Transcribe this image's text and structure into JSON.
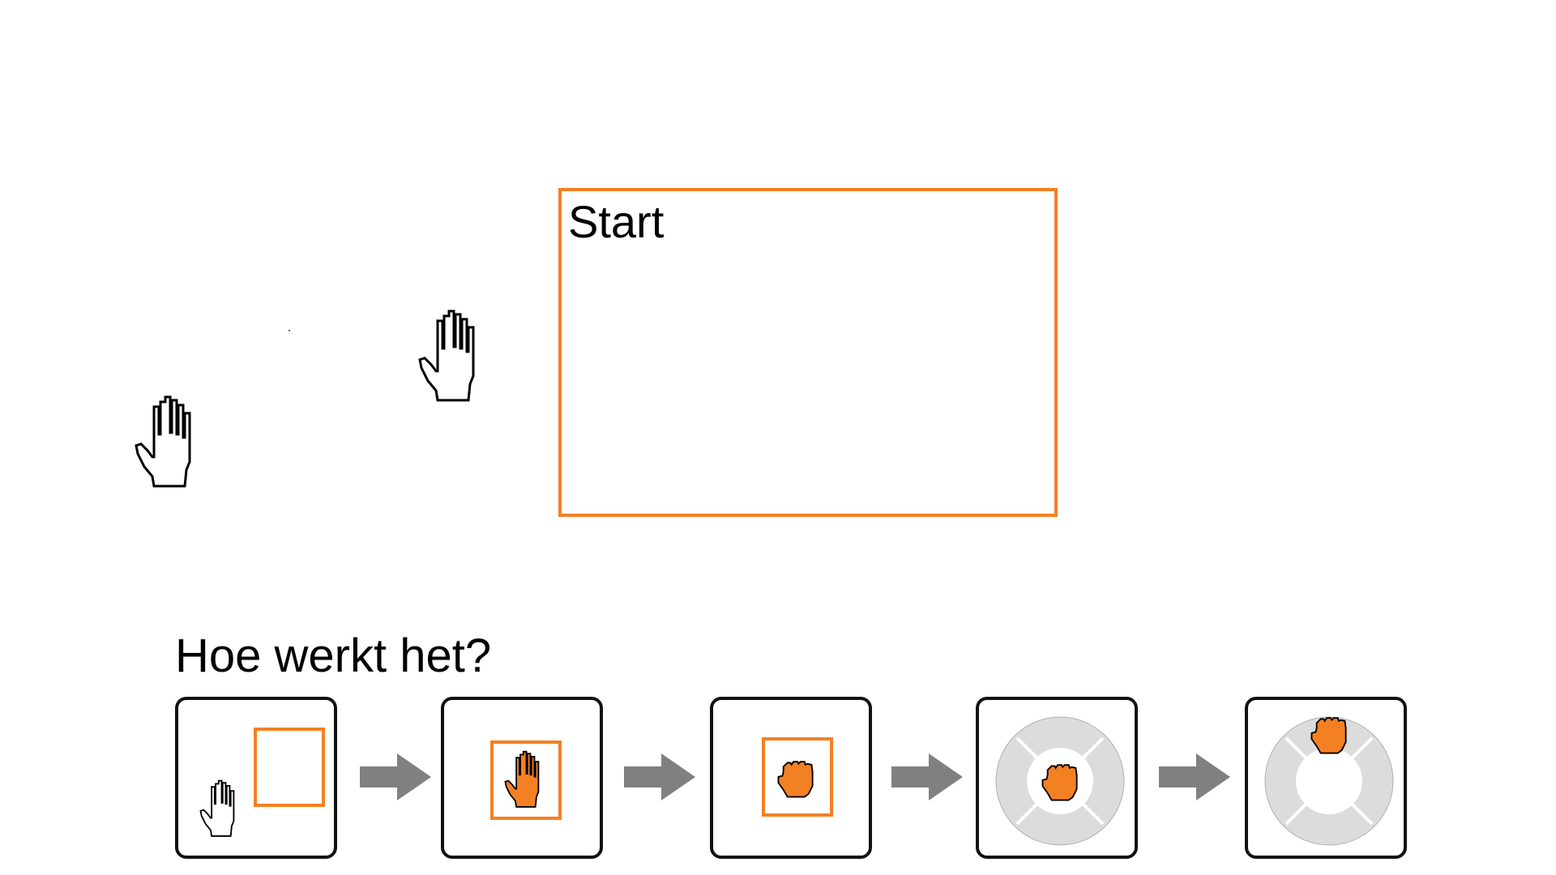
{
  "start": {
    "label": "Start"
  },
  "howto": {
    "title": "Hoe werkt het?",
    "steps": [
      {
        "icon": "open-hand-icon",
        "target": "empty-square-target"
      },
      {
        "icon": "orange-open-hand-icon",
        "target": "square-target"
      },
      {
        "icon": "orange-grab-hand-icon",
        "target": "square-target"
      },
      {
        "icon": "orange-grab-hand-icon",
        "target": "ring-menu"
      },
      {
        "icon": "orange-grab-hand-icon",
        "target": "ring-menu-top"
      }
    ]
  },
  "colors": {
    "accent": "#f48024",
    "ring": "#dcdcdc",
    "arrow": "#808080",
    "outline": "#111111"
  }
}
